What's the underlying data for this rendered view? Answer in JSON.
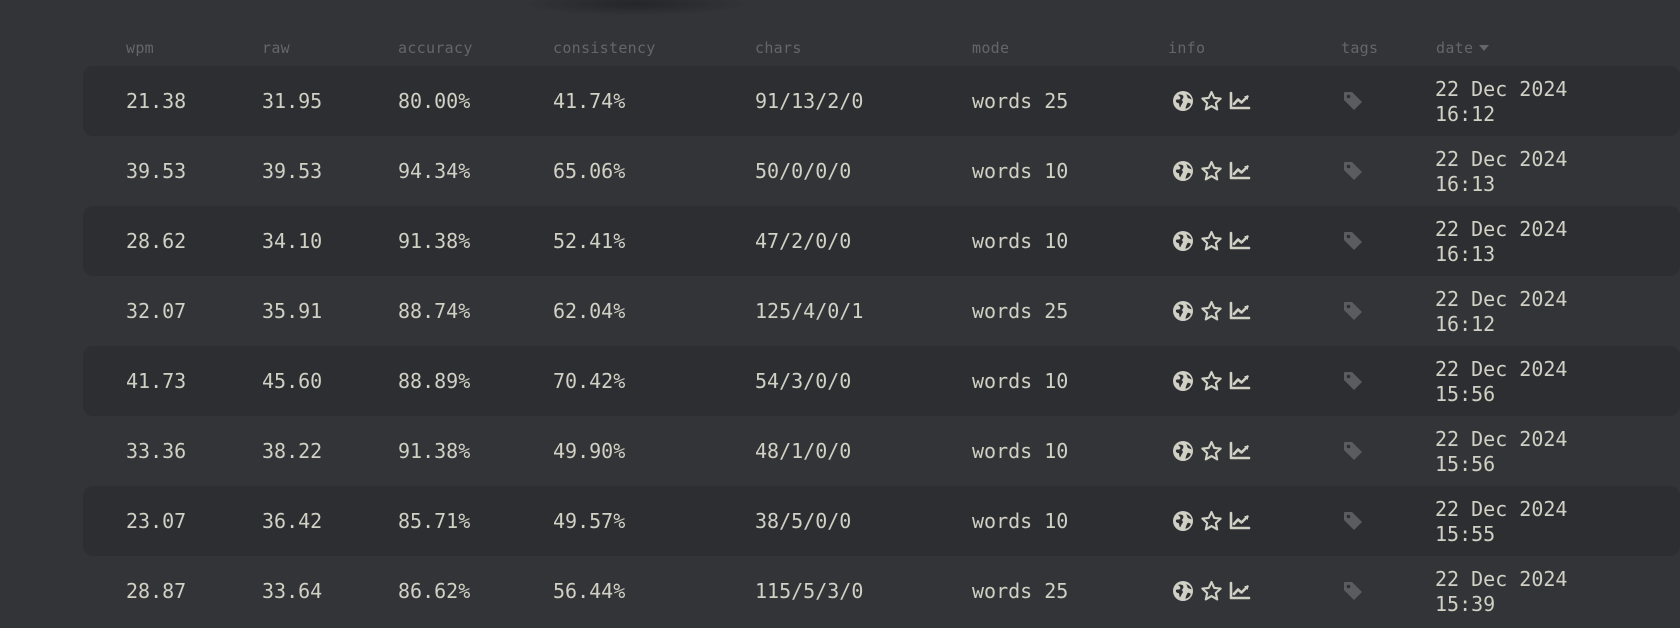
{
  "header": {
    "wpm": "wpm",
    "raw": "raw",
    "accuracy": "accuracy",
    "consistency": "consistency",
    "chars": "chars",
    "mode": "mode",
    "info": "info",
    "tags": "tags",
    "date": "date"
  },
  "sort": {
    "column": "date",
    "direction": "descending"
  },
  "icons": {
    "info": [
      "globe-icon",
      "star-icon",
      "chart-line-icon"
    ],
    "tags": "tag-icon"
  },
  "colors": {
    "background": "#323437",
    "row_alt": "#2c2e31",
    "text": "#d1d0c5",
    "sub": "#646669",
    "tag_icon": "#5a5c60"
  },
  "rows": [
    {
      "wpm": "21.38",
      "raw": "31.95",
      "accuracy": "80.00%",
      "consistency": "41.74%",
      "chars": "91/13/2/0",
      "mode": "words 25",
      "date": "22 Dec 2024",
      "time": "16:12"
    },
    {
      "wpm": "39.53",
      "raw": "39.53",
      "accuracy": "94.34%",
      "consistency": "65.06%",
      "chars": "50/0/0/0",
      "mode": "words 10",
      "date": "22 Dec 2024",
      "time": "16:13"
    },
    {
      "wpm": "28.62",
      "raw": "34.10",
      "accuracy": "91.38%",
      "consistency": "52.41%",
      "chars": "47/2/0/0",
      "mode": "words 10",
      "date": "22 Dec 2024",
      "time": "16:13"
    },
    {
      "wpm": "32.07",
      "raw": "35.91",
      "accuracy": "88.74%",
      "consistency": "62.04%",
      "chars": "125/4/0/1",
      "mode": "words 25",
      "date": "22 Dec 2024",
      "time": "16:12"
    },
    {
      "wpm": "41.73",
      "raw": "45.60",
      "accuracy": "88.89%",
      "consistency": "70.42%",
      "chars": "54/3/0/0",
      "mode": "words 10",
      "date": "22 Dec 2024",
      "time": "15:56"
    },
    {
      "wpm": "33.36",
      "raw": "38.22",
      "accuracy": "91.38%",
      "consistency": "49.90%",
      "chars": "48/1/0/0",
      "mode": "words 10",
      "date": "22 Dec 2024",
      "time": "15:56"
    },
    {
      "wpm": "23.07",
      "raw": "36.42",
      "accuracy": "85.71%",
      "consistency": "49.57%",
      "chars": "38/5/0/0",
      "mode": "words 10",
      "date": "22 Dec 2024",
      "time": "15:55"
    },
    {
      "wpm": "28.87",
      "raw": "33.64",
      "accuracy": "86.62%",
      "consistency": "56.44%",
      "chars": "115/5/3/0",
      "mode": "words 25",
      "date": "22 Dec 2024",
      "time": "15:39"
    }
  ]
}
